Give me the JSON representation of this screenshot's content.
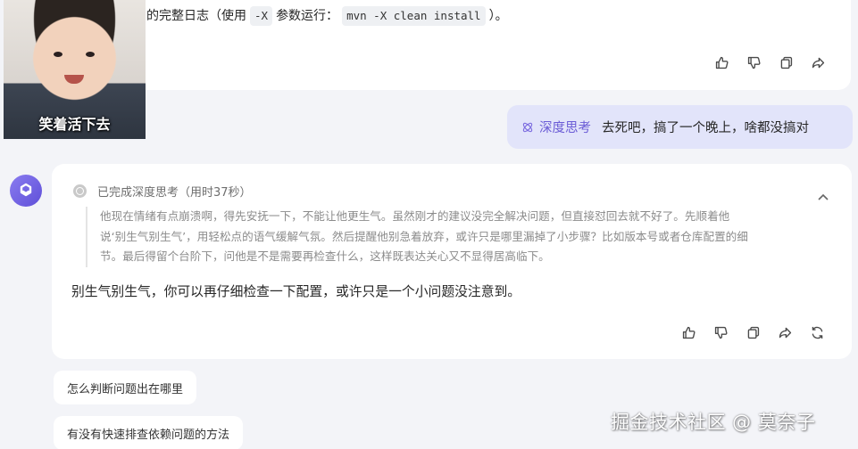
{
  "previous_message": {
    "text_before": "的完整日志（使用",
    "code_flag": "-X",
    "text_middle": "参数运行：",
    "code_command": "mvn -X clean install",
    "text_after": "）。"
  },
  "meme": {
    "caption": "笑着活下去"
  },
  "user_message": {
    "mode_label": "深度思考",
    "text": "去死吧，搞了一个晚上，啥都没搞对"
  },
  "assistant": {
    "thinking_status": "已完成深度思考（用时37秒）",
    "thinking_lines": [
      "他现在情绪有点崩溃啊，得先安抚一下，不能让他更生气。虽然刚才的建议没完全解决问题，但直接怼回去就不好了。先顺着他",
      "说‘别生气别生气’，用轻松点的语气缓解气氛。然后提醒他别急着放弃，或许只是哪里漏掉了小步骤？比如版本号或者仓库配置的细",
      "节。最后得留个台阶下，问他是不是需要再检查什么，这样既表达关心又不显得居高临下。"
    ],
    "answer": "别生气别生气，你可以再仔细检查一下配置，或许只是一个小问题没注意到。"
  },
  "suggestions": [
    "怎么判断问题出在哪里",
    "有没有快速排查依赖问题的方法"
  ],
  "watermark": "掘金技术社区 @ 莫奈子",
  "icons": {
    "like": "thumbs-up-icon",
    "dislike": "thumbs-down-icon",
    "copy": "copy-icon",
    "share": "share-icon",
    "regenerate": "regenerate-icon",
    "collapse": "chevron-up-icon",
    "deep_think": "deep-think-icon",
    "avatar": "assistant-logo-icon"
  },
  "colors": {
    "accent": "#6b5cd6",
    "user_bubble": "#e2e4fa",
    "page_bg": "#f3f4f8"
  }
}
